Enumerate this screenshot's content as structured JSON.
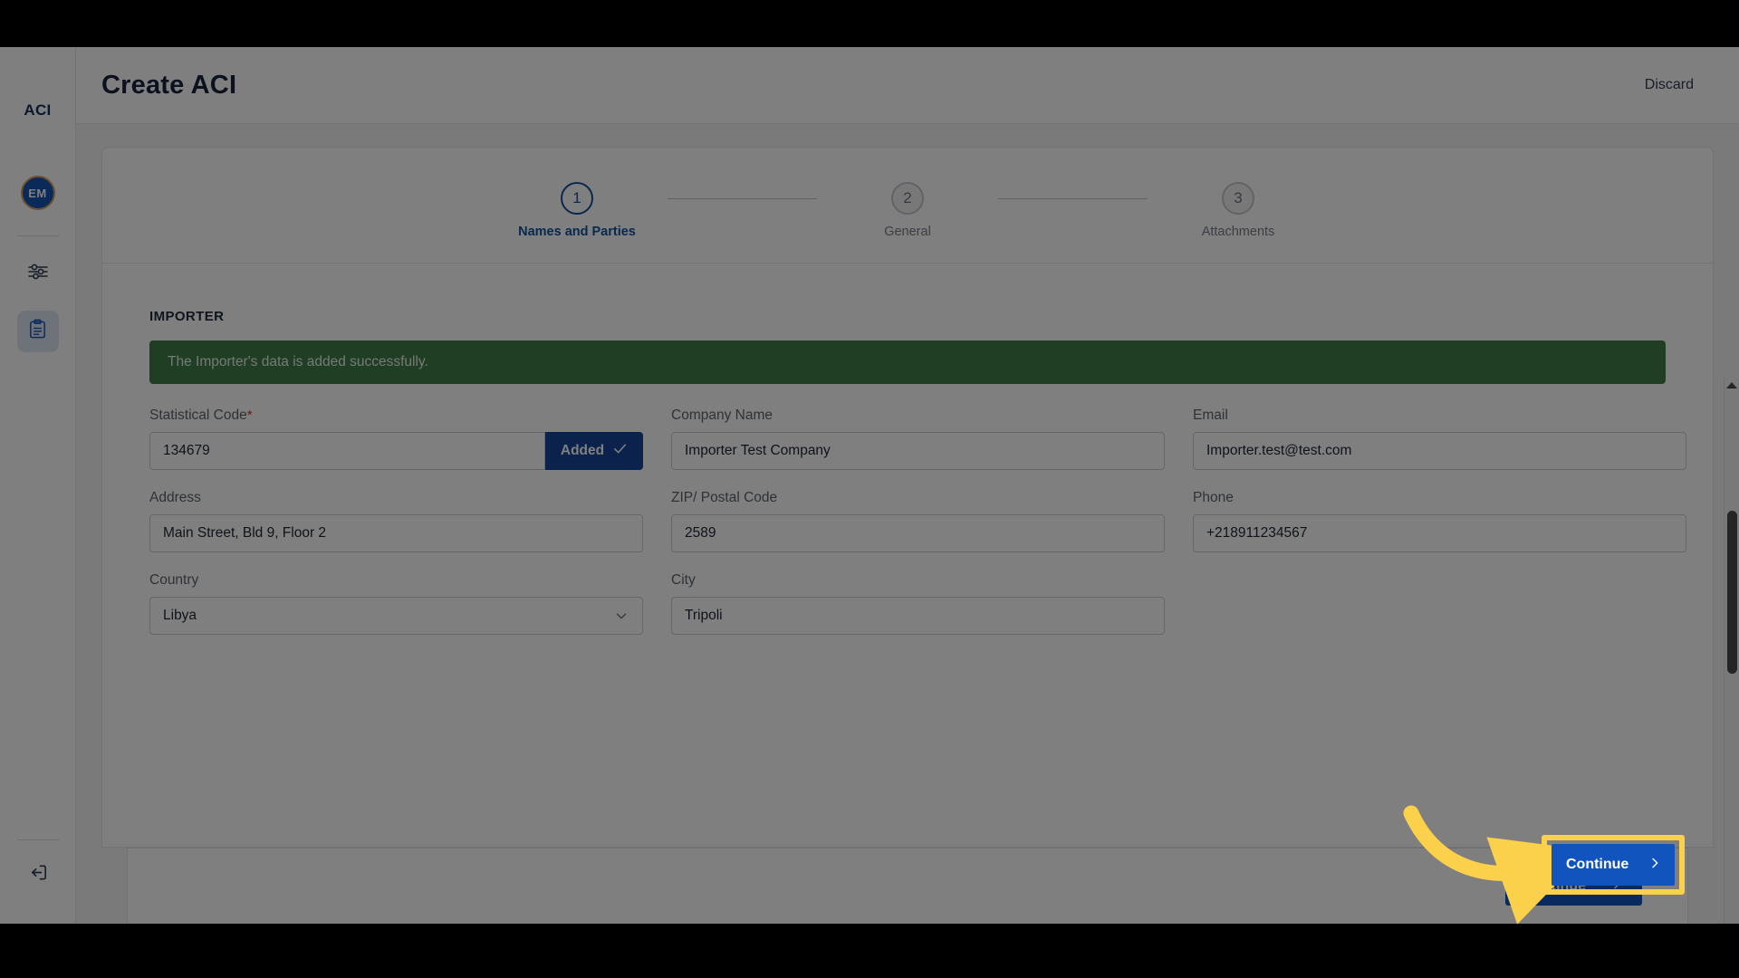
{
  "sidebar": {
    "brand": "ACI",
    "avatar_initials": "EM",
    "items": [
      {
        "name": "settings-sliders",
        "icon": "sliders-icon",
        "active": false
      },
      {
        "name": "aci-declarations",
        "icon": "clipboard-icon",
        "active": true
      }
    ],
    "logout_icon": "logout-icon"
  },
  "topbar": {
    "title": "Create ACI",
    "discard_label": "Discard"
  },
  "stepper": {
    "steps": [
      {
        "number": "1",
        "label": "Names and Parties",
        "state": "active"
      },
      {
        "number": "2",
        "label": "General",
        "state": "upcoming"
      },
      {
        "number": "3",
        "label": "Attachments",
        "state": "upcoming"
      }
    ]
  },
  "form": {
    "section_title": "IMPORTER",
    "alert": {
      "text": "The Importer's data is added successfully.",
      "type": "success",
      "bg_color": "#3e7d47",
      "text_color": "#e8f5e9"
    },
    "fields": {
      "statistical_code": {
        "label": "Statistical Code",
        "required": true,
        "required_marker": "*",
        "value": "134679",
        "placeholder": "Statistical Code",
        "action_label": "Added",
        "action_icon": "check-icon"
      },
      "company_name": {
        "label": "Company Name",
        "value": "Importer Test Company",
        "placeholder": "Company Name"
      },
      "email": {
        "label": "Email",
        "value": "Importer.test@test.com",
        "placeholder": "Email"
      },
      "address": {
        "label": "Address",
        "value": "Main Street, Bld 9, Floor 2",
        "placeholder": "Address"
      },
      "zip_postal_code": {
        "label": "ZIP/ Postal Code",
        "value": "2589",
        "placeholder": "ZIP/ Postal Code"
      },
      "phone": {
        "label": "Phone",
        "value": "+218911234567",
        "placeholder": "Phone"
      },
      "country": {
        "label": "Country",
        "value": "Libya",
        "placeholder": "Country",
        "icon": "chevron-down-icon"
      },
      "city": {
        "label": "City",
        "value": "Tripoli",
        "placeholder": "City"
      }
    }
  },
  "footer": {
    "continue_label": "Continue",
    "continue_icon": "chevron-right-icon",
    "continue_color": "#1254bd"
  },
  "annotation": {
    "highlight_color": "#fbd04b",
    "arrow_color": "#fbd04b",
    "target": "continue-button"
  },
  "scrollbar": {
    "up_icon": "caret-up-icon",
    "down_icon": "caret-down-icon"
  }
}
